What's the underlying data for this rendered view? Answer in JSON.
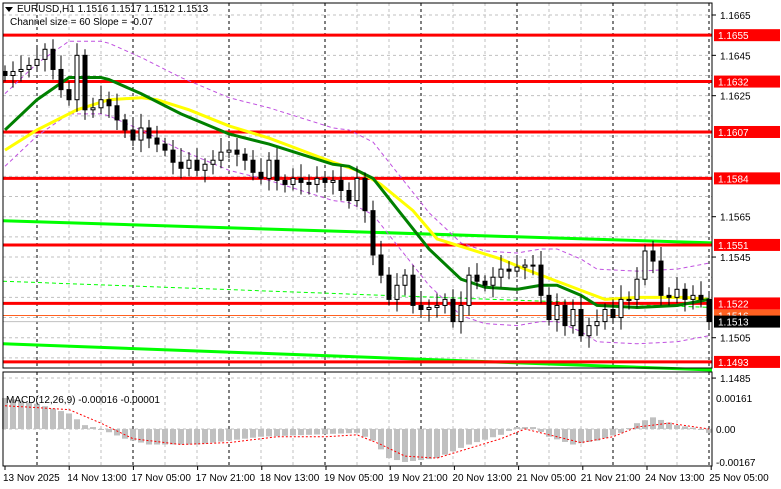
{
  "header": {
    "symbol_line": "EURUSD,H1  1.1516 1.1517 1.1512 1.1513",
    "channel_line": "Channel size = 60 Slope = -0.07"
  },
  "macd_header": "MACD(12,26,9) -0.00016 -0.00001",
  "colors": {
    "level_line": "#ff0000",
    "fast_ma": "#008000",
    "slow_ma": "#ffff00",
    "channel": "#00ff00",
    "bands": "#c050e0",
    "histogram": "#c0c0c0",
    "signal": "#ff0000",
    "bid_line": "#c0c0c0",
    "ask_line": "#ff6020"
  },
  "chart_data": [
    {
      "type": "candlestick",
      "title": "EURUSD,H1",
      "ylim": [
        1.148,
        1.167
      ],
      "price_ticks": [
        "1.1665",
        "1.1645",
        "1.1625",
        "1.1565",
        "1.1545",
        "1.1505",
        "1.1485"
      ],
      "time_ticks": [
        "13 Nov 2025",
        "14 Nov 13:00",
        "17 Nov 05:00",
        "17 Nov 21:00",
        "18 Nov 13:00",
        "19 Nov 05:00",
        "19 Nov 21:00",
        "20 Nov 13:00",
        "21 Nov 05:00",
        "21 Nov 21:00",
        "24 Nov 13:00",
        "25 Nov 05:00"
      ],
      "closes": [
        1.1635,
        1.1637,
        1.1638,
        1.164,
        1.1643,
        1.1648,
        1.1638,
        1.1628,
        1.1623,
        1.1645,
        1.1618,
        1.1619,
        1.1623,
        1.162,
        1.1613,
        1.1608,
        1.1603,
        1.1609,
        1.1604,
        1.1601,
        1.1598,
        1.1592,
        1.1589,
        1.1593,
        1.1588,
        1.1591,
        1.1593,
        1.1597,
        1.1598,
        1.1596,
        1.1593,
        1.1587,
        1.1584,
        1.1593,
        1.1583,
        1.1581,
        1.1584,
        1.1582,
        1.1581,
        1.1584,
        1.1582,
        1.1583,
        1.1578,
        1.1573,
        1.1584,
        1.1568,
        1.1546,
        1.1536,
        1.1524,
        1.1531,
        1.1536,
        1.1521,
        1.1519,
        1.152,
        1.1521,
        1.1524,
        1.1513,
        1.1521,
        1.1536,
        1.1533,
        1.1531,
        1.1535,
        1.1539,
        1.1538,
        1.154,
        1.1541,
        1.1541,
        1.1526,
        1.1514,
        1.1521,
        1.1511,
        1.1519,
        1.1506,
        1.1511,
        1.1513,
        1.1519,
        1.1515,
        1.1524,
        1.1524,
        1.1534,
        1.1548,
        1.1543,
        1.1526,
        1.1525,
        1.1529,
        1.1524,
        1.1526,
        1.1524,
        1.1513
      ],
      "fast_ma": [
        [
          0,
          1.1608
        ],
        [
          4,
          1.1623
        ],
        [
          8,
          1.1634
        ],
        [
          12,
          1.1634
        ],
        [
          13,
          1.1633
        ],
        [
          17,
          1.1626
        ],
        [
          22,
          1.1616
        ],
        [
          28,
          1.1606
        ],
        [
          33,
          1.1601
        ],
        [
          37,
          1.1596
        ],
        [
          41,
          1.1591
        ],
        [
          43,
          1.159
        ],
        [
          46,
          1.1584
        ],
        [
          49,
          1.1569
        ],
        [
          53,
          1.1549
        ],
        [
          57,
          1.1534
        ],
        [
          60,
          1.153
        ],
        [
          64,
          1.1529
        ],
        [
          67,
          1.1531
        ],
        [
          69,
          1.1531
        ],
        [
          72,
          1.1526
        ],
        [
          74,
          1.1521
        ],
        [
          79,
          1.152
        ],
        [
          84,
          1.1521
        ],
        [
          88,
          1.1524
        ]
      ],
      "slow_ma": [
        [
          0,
          1.1598
        ],
        [
          4,
          1.1608
        ],
        [
          9,
          1.1618
        ],
        [
          13,
          1.1623
        ],
        [
          17,
          1.1624
        ],
        [
          19,
          1.1623
        ],
        [
          23,
          1.1618
        ],
        [
          28,
          1.161
        ],
        [
          33,
          1.1604
        ],
        [
          37,
          1.1598
        ],
        [
          41,
          1.1592
        ],
        [
          44,
          1.1588
        ],
        [
          47,
          1.1581
        ],
        [
          51,
          1.1568
        ],
        [
          54,
          1.1554
        ],
        [
          58,
          1.1549
        ],
        [
          62,
          1.1544
        ],
        [
          65,
          1.1539
        ],
        [
          69,
          1.1533
        ],
        [
          73,
          1.1527
        ],
        [
          75,
          1.1524
        ],
        [
          79,
          1.1525
        ],
        [
          82,
          1.1525
        ],
        [
          85,
          1.1525
        ],
        [
          88,
          1.1524
        ]
      ],
      "channel": {
        "upper": [
          1.1563,
          1.1552
        ],
        "middle": [
          1.1533,
          1.152
        ],
        "lower": [
          1.1502,
          1.1489
        ]
      },
      "band_width": 0.0018,
      "levels": [
        "1.1655",
        "1.1632",
        "1.1607",
        "1.1584",
        "1.1551",
        "1.1522",
        "1.1493"
      ],
      "ask_label": "1.1516",
      "bid_label": "1.1513"
    },
    {
      "type": "macd",
      "title": "MACD(12,26,9)",
      "ylim": [
        -0.00167,
        0.00161
      ],
      "ticks": [
        "0.00161",
        "0.00",
        "-0.00167"
      ],
      "histogram": [
        [
          0,
          0.0016
        ],
        [
          4,
          0.0013
        ],
        [
          8,
          0.0008
        ],
        [
          10,
          0.0002
        ],
        [
          12,
          0.0
        ],
        [
          15,
          -0.0005
        ],
        [
          18,
          -0.0008
        ],
        [
          24,
          -0.0008
        ],
        [
          28,
          -0.0006
        ],
        [
          32,
          -0.0004
        ],
        [
          38,
          -0.0003
        ],
        [
          44,
          -0.0002
        ],
        [
          46,
          -0.0006
        ],
        [
          48,
          -0.0015
        ],
        [
          50,
          -0.0017
        ],
        [
          54,
          -0.0015
        ],
        [
          58,
          -0.0008
        ],
        [
          62,
          -0.0003
        ],
        [
          64,
          0.0001
        ],
        [
          66,
          0.0001
        ],
        [
          68,
          -0.0004
        ],
        [
          71,
          -0.0008
        ],
        [
          74,
          -0.0006
        ],
        [
          77,
          -0.0002
        ],
        [
          79,
          0.0003
        ],
        [
          81,
          0.0006
        ],
        [
          84,
          0.0002
        ],
        [
          87,
          0.0
        ],
        [
          88,
          -0.0002
        ]
      ],
      "signal": [
        [
          0,
          0.0012
        ],
        [
          8,
          0.001
        ],
        [
          12,
          0.0003
        ],
        [
          16,
          -0.0005
        ],
        [
          22,
          -0.0008
        ],
        [
          28,
          -0.0007
        ],
        [
          34,
          -0.0004
        ],
        [
          40,
          -0.0004
        ],
        [
          44,
          -0.0003
        ],
        [
          47,
          -0.0008
        ],
        [
          50,
          -0.0014
        ],
        [
          54,
          -0.0015
        ],
        [
          58,
          -0.001
        ],
        [
          62,
          -0.0005
        ],
        [
          65,
          0.0
        ],
        [
          68,
          -0.0003
        ],
        [
          72,
          -0.0007
        ],
        [
          76,
          -0.0004
        ],
        [
          79,
          0.0001
        ],
        [
          83,
          0.0003
        ],
        [
          88,
          0.0
        ]
      ]
    }
  ]
}
